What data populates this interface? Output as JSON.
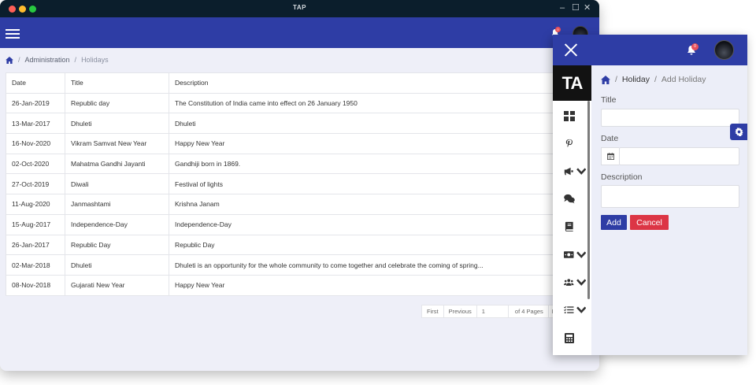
{
  "window": {
    "title": "TAP",
    "controls": [
      "–",
      "☐",
      "✕"
    ]
  },
  "back": {
    "notification_count": "0",
    "breadcrumb": {
      "items": [
        "Administration",
        "Holidays"
      ],
      "separator": "/"
    },
    "table": {
      "headers": [
        "Date",
        "Title",
        "Description"
      ],
      "rows": [
        [
          "26-Jan-2019",
          "Republic day",
          "The Constitution of India came into effect on 26 January 1950"
        ],
        [
          "13-Mar-2017",
          "Dhuleti",
          "Dhuleti"
        ],
        [
          "16-Nov-2020",
          "Vikram Samvat New Year",
          "Happy New Year"
        ],
        [
          "02-Oct-2020",
          "Mahatma Gandhi Jayanti",
          "Gandhiji born in 1869."
        ],
        [
          "27-Oct-2019",
          "Diwali",
          "Festival of lights"
        ],
        [
          "11-Aug-2020",
          "Janmashtami",
          "Krishna Janam"
        ],
        [
          "15-Aug-2017",
          "Independence-Day",
          "Independence-Day"
        ],
        [
          "26-Jan-2017",
          "Republic Day",
          "Republic Day"
        ],
        [
          "02-Mar-2018",
          "Dhuleti",
          "Dhuleti is an opportunity for the whole community to come together and celebrate the coming of spring..."
        ],
        [
          "08-Nov-2018",
          "Gujarati New Year",
          "Happy New Year"
        ]
      ]
    },
    "pager": {
      "first": "First",
      "previous": "Previous",
      "page": "1",
      "of_pages": "of 4 Pages",
      "next_partial": "N"
    }
  },
  "front": {
    "notification_count": "0",
    "logo": "TA",
    "breadcrumb": {
      "items": [
        "Holiday",
        "Add Holiday"
      ],
      "separator": "/"
    },
    "form": {
      "title_label": "Title",
      "title_value": "",
      "date_label": "Date",
      "date_value": "",
      "description_label": "Description",
      "description_value": "",
      "add_label": "Add",
      "cancel_label": "Cancel"
    },
    "sidebar_icons": [
      "dashboard-icon",
      "pinterest-icon",
      "megaphone-icon",
      "comments-icon",
      "book-icon",
      "money-icon",
      "users-icon",
      "tasks-icon",
      "calculator-icon"
    ]
  },
  "colors": {
    "primary": "#2e3da5",
    "danger": "#dc3545",
    "titlebar": "#0b1e2c",
    "background": "#eeeff8"
  }
}
